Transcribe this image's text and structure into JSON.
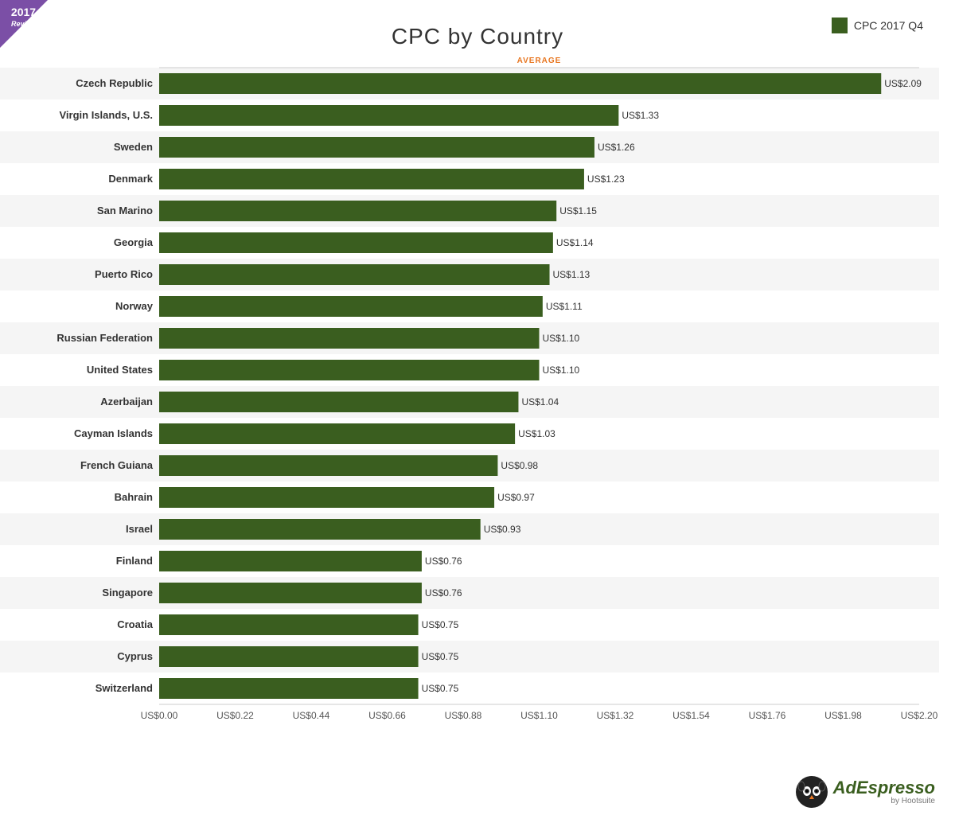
{
  "title": "CPC by Country",
  "badge": {
    "year": "2017",
    "text": "Review"
  },
  "legend": {
    "color": "#3a5e1f",
    "label": "CPC 2017 Q4"
  },
  "average_label": "AVERAGE",
  "max_value": 2.2,
  "average_value": 1.1,
  "countries": [
    {
      "name": "Czech Republic",
      "value": 2.09
    },
    {
      "name": "Virgin Islands, U.S.",
      "value": 1.33
    },
    {
      "name": "Sweden",
      "value": 1.26
    },
    {
      "name": "Denmark",
      "value": 1.23
    },
    {
      "name": "San Marino",
      "value": 1.15
    },
    {
      "name": "Georgia",
      "value": 1.14
    },
    {
      "name": "Puerto Rico",
      "value": 1.13
    },
    {
      "name": "Norway",
      "value": 1.11
    },
    {
      "name": "Russian Federation",
      "value": 1.1
    },
    {
      "name": "United States",
      "value": 1.1
    },
    {
      "name": "Azerbaijan",
      "value": 1.04
    },
    {
      "name": "Cayman Islands",
      "value": 1.03
    },
    {
      "name": "French Guiana",
      "value": 0.98
    },
    {
      "name": "Bahrain",
      "value": 0.97
    },
    {
      "name": "Israel",
      "value": 0.93
    },
    {
      "name": "Finland",
      "value": 0.76
    },
    {
      "name": "Singapore",
      "value": 0.76
    },
    {
      "name": "Croatia",
      "value": 0.75
    },
    {
      "name": "Cyprus",
      "value": 0.75
    },
    {
      "name": "Switzerland",
      "value": 0.75
    }
  ],
  "x_axis_labels": [
    "US$0.00",
    "US$0.22",
    "US$0.44",
    "US$0.66",
    "US$0.88",
    "US$1.10",
    "US$1.32",
    "US$1.54",
    "US$1.76",
    "US$1.98",
    "US$2.20"
  ],
  "footer": {
    "adespresso": "AdEspresso",
    "by_hootsuite": "by Hootsuite"
  }
}
